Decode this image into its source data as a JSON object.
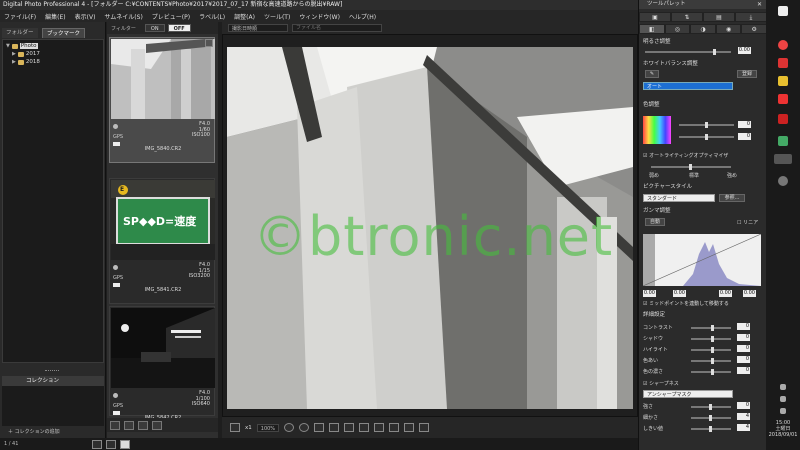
{
  "window_title": "Digital Photo Professional 4 - [フォルダー C:¥CONTENTS¥Photo¥2017¥2017_07_17 新宿な高速道路からの脱出¥RAW]",
  "menu": [
    "ファイル(F)",
    "編集(E)",
    "表示(V)",
    "サムネイル(S)",
    "プレビュー(P)",
    "ラベル(L)",
    "調整(A)",
    "ツール(T)",
    "ウィンドウ(W)",
    "ヘルプ(H)"
  ],
  "left_panel": {
    "tab_folder": "フォルダー",
    "tab_bookmark": "ブックマーク",
    "tree": [
      {
        "label": "Photo"
      },
      {
        "label": "2017"
      },
      {
        "label": "2018"
      }
    ],
    "collection_header": "コレクション",
    "add_collection": "コレクションの追加"
  },
  "filter": {
    "label": "フィルター",
    "on": "ON",
    "off": "OFF"
  },
  "preview_bar": {
    "sort": "撮影日時順",
    "filename_placeholder": "ファイル名"
  },
  "thumbnails": [
    {
      "exif": [
        "F4.0",
        "1/60",
        "ISO100"
      ],
      "gps": "GPS",
      "filename": "IMG_5840.CR2"
    },
    {
      "exif": [
        "F4.0",
        "1/15",
        "ISO3200"
      ],
      "gps": "GPS",
      "filename": "IMG_5841.CR2",
      "sign_text": "SP◆◆D=速度",
      "badge": "E"
    },
    {
      "exif": [
        "F4.0",
        "1/100",
        "ISO640"
      ],
      "gps": "GPS",
      "filename": "IMG_5842.CR2"
    }
  ],
  "preview": {
    "watermark": "©btronic.net"
  },
  "bottom_bar": {
    "zoom_fit": "x1",
    "zoom_pct": "100%"
  },
  "status": {
    "count": "1 / 41"
  },
  "palette": {
    "title": "ツールパレット",
    "tabs": [
      "RAW",
      "調整",
      "トリム",
      "☼",
      "色",
      "設定"
    ],
    "brightness_label": "明るさ調整",
    "brightness_value": "0.00",
    "wb_label": "ホワイトバランス調整",
    "wb_btn_register": "登録",
    "wb_select": "オート",
    "tone_label": "色調整",
    "tone_values": [
      "0",
      "0"
    ],
    "auto_lighting": "オートライティングオプティマイザ",
    "auto_low": "弱め",
    "auto_std": "標準",
    "auto_high": "強め",
    "picture_style_label": "ピクチャースタイル",
    "picture_style_value": "スタンダード",
    "picture_style_btn": "参照...",
    "gamma_label": "ガンマ調整",
    "gamma_auto": "自動",
    "gamma_linear": "リニア",
    "gamma_values": [
      "0.00",
      "0.00",
      "0.00",
      "0.00"
    ],
    "gamma_link": "ミッドポイントを連動して移動する",
    "detail_label": "詳細設定",
    "details": [
      {
        "label": "コントラスト",
        "value": "0"
      },
      {
        "label": "シャドウ",
        "value": "0"
      },
      {
        "label": "ハイライト",
        "value": "0"
      },
      {
        "label": "色あい",
        "value": "0"
      },
      {
        "label": "色の濃さ",
        "value": "0"
      }
    ],
    "sharpness_label": "シャープネス",
    "sharpness_select": "アンシャープマスク",
    "sharpness": [
      {
        "label": "強さ",
        "value": "0"
      },
      {
        "label": "細かさ",
        "value": "4"
      },
      {
        "label": "しきい値",
        "value": "4"
      }
    ]
  },
  "taskbar": {
    "time": "15:00",
    "day": "土曜日",
    "date": "2018/09/01"
  }
}
